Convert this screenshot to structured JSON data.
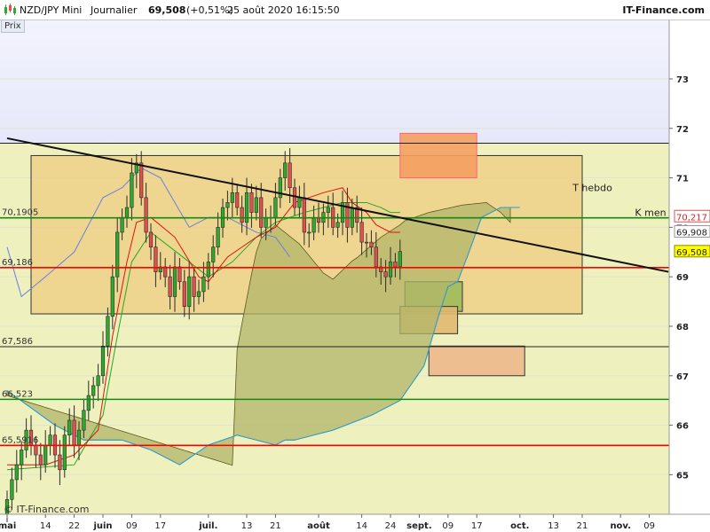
{
  "header": {
    "symbol": "NZD/JPY Mini",
    "period": "Journalier",
    "last": "69,508",
    "change": "(+0,51%)",
    "datetime": "25 août 2020 16:15:50",
    "brand": "IT-Finance.com",
    "panel_tab": "Prix",
    "watermark": "© IT-Finance.com"
  },
  "colors": {
    "bull": "#2eaa2e",
    "bear": "#e05050",
    "tenkan": "#e01010",
    "kijun": "#22aa22",
    "chikou": "#6a7fe0",
    "ssb": "#22a0dd",
    "cloud_green": "#b2b66a",
    "cloud_bear": "#c6b06a",
    "trend": "#111111",
    "support_red": "#ff0000",
    "support_green": "#138a13"
  },
  "chart_data": {
    "type": "candlestick",
    "instrument": "NZD/JPY Mini",
    "timeframe": "Journalier",
    "y_axis": {
      "ylim": [
        64.2,
        74.2
      ],
      "ticks": [
        65,
        66,
        67,
        68,
        69,
        70,
        71,
        72,
        73
      ]
    },
    "x_axis": {
      "ticks": [
        {
          "label": "mai",
          "bold": true,
          "i": 0
        },
        {
          "label": "14",
          "i": 8
        },
        {
          "label": "22",
          "i": 14
        },
        {
          "label": "juin",
          "bold": true,
          "i": 20
        },
        {
          "label": "09",
          "i": 26
        },
        {
          "label": "17",
          "i": 32
        },
        {
          "label": "juil.",
          "bold": true,
          "i": 42
        },
        {
          "label": "13",
          "i": 50
        },
        {
          "label": "21",
          "i": 56
        },
        {
          "label": "août",
          "bold": true,
          "i": 65
        },
        {
          "label": "14",
          "i": 74
        },
        {
          "label": "24",
          "i": 80
        },
        {
          "label": "sept.",
          "bold": true,
          "i": 86
        },
        {
          "label": "09",
          "i": 92
        },
        {
          "label": "17",
          "i": 98
        },
        {
          "label": "oct.",
          "bold": true,
          "i": 107
        },
        {
          "label": "13",
          "i": 114
        },
        {
          "label": "21",
          "i": 120
        },
        {
          "label": "nov.",
          "bold": true,
          "i": 128
        },
        {
          "label": "09",
          "i": 134
        }
      ]
    },
    "candles_close": [
      64.5,
      64.9,
      65.2,
      65.5,
      65.9,
      65.6,
      65.4,
      65.2,
      65.6,
      65.8,
      65.4,
      65.1,
      65.8,
      66.1,
      65.6,
      65.9,
      66.3,
      66.6,
      66.8,
      67.0,
      67.6,
      68.2,
      69.0,
      69.9,
      70.2,
      70.4,
      71.1,
      71.3,
      70.6,
      69.9,
      69.6,
      69.1,
      69.2,
      69.0,
      68.6,
      69.2,
      68.9,
      68.4,
      69.0,
      68.6,
      68.7,
      69.0,
      69.3,
      69.6,
      70.0,
      70.4,
      70.5,
      70.7,
      70.4,
      70.1,
      70.7,
      70.3,
      70.6,
      70.0,
      70.2,
      70.2,
      70.6,
      71.0,
      71.3,
      70.8,
      70.4,
      70.6,
      69.9,
      69.9,
      70.2,
      70.1,
      70.3,
      70.4,
      70.0,
      70.1,
      70.5,
      70.0,
      70.4,
      70.1,
      69.7,
      69.7,
      69.6,
      69.2,
      69.1,
      69.0,
      69.3,
      69.2,
      69.51
    ],
    "tenkan": [
      [
        0,
        65.2
      ],
      [
        8,
        65.2
      ],
      [
        14,
        65.4
      ],
      [
        19,
        65.9
      ],
      [
        22,
        67.8
      ],
      [
        25,
        69.3
      ],
      [
        27,
        70.1
      ],
      [
        30,
        70.2
      ],
      [
        35,
        69.8
      ],
      [
        40,
        69.0
      ],
      [
        42,
        68.9
      ],
      [
        46,
        69.4
      ],
      [
        52,
        69.8
      ],
      [
        56,
        70.0
      ],
      [
        60,
        70.5
      ],
      [
        66,
        70.7
      ],
      [
        70,
        70.8
      ],
      [
        72,
        70.5
      ],
      [
        75,
        70.3
      ],
      [
        77,
        70.05
      ],
      [
        80,
        69.9
      ],
      [
        82,
        69.9
      ]
    ],
    "kijun": [
      [
        0,
        65.1
      ],
      [
        14,
        65.2
      ],
      [
        20,
        66.2
      ],
      [
        23,
        67.8
      ],
      [
        26,
        69.3
      ],
      [
        30,
        69.9
      ],
      [
        38,
        69.3
      ],
      [
        42,
        69.0
      ],
      [
        47,
        69.3
      ],
      [
        52,
        69.8
      ],
      [
        56,
        70.1
      ],
      [
        62,
        70.3
      ],
      [
        70,
        70.5
      ],
      [
        75,
        70.5
      ],
      [
        78,
        70.4
      ],
      [
        80,
        70.3
      ],
      [
        82,
        70.3
      ]
    ],
    "chikou": [
      [
        0,
        69.6
      ],
      [
        3,
        68.6
      ],
      [
        8,
        69.0
      ],
      [
        14,
        69.5
      ],
      [
        20,
        70.6
      ],
      [
        24,
        70.8
      ],
      [
        28,
        71.2
      ],
      [
        32,
        71.0
      ],
      [
        38,
        70.0
      ],
      [
        42,
        70.2
      ],
      [
        46,
        70.2
      ],
      [
        52,
        69.9
      ],
      [
        56,
        69.8
      ],
      [
        59,
        69.4
      ]
    ],
    "ssb": [
      [
        0,
        66.7
      ],
      [
        10,
        66.0
      ],
      [
        16,
        65.7
      ],
      [
        24,
        65.7
      ],
      [
        30,
        65.5
      ],
      [
        36,
        65.2
      ],
      [
        42,
        65.6
      ],
      [
        48,
        65.8
      ],
      [
        52,
        65.7
      ],
      [
        56,
        65.6
      ],
      [
        58,
        65.7
      ],
      [
        60,
        65.7
      ],
      [
        68,
        65.9
      ],
      [
        76,
        66.2
      ],
      [
        82,
        66.5
      ],
      [
        87,
        67.2
      ],
      [
        90,
        68.2
      ],
      [
        92,
        68.8
      ],
      [
        94,
        68.9
      ],
      [
        96,
        69.4
      ],
      [
        99,
        70.2
      ],
      [
        103,
        70.4
      ],
      [
        107,
        70.4
      ]
    ],
    "ssa_future": [
      [
        82,
        70.1
      ],
      [
        88,
        70.3
      ],
      [
        95,
        70.45
      ],
      [
        100,
        70.5
      ],
      [
        103,
        70.3
      ],
      [
        105,
        70.1
      ]
    ],
    "levels": [
      {
        "value": 70.1905,
        "label": "70,1905",
        "color": "green"
      },
      {
        "value": 69.186,
        "label": "69,186",
        "color": "red"
      },
      {
        "value": 67.586,
        "label": "67,586",
        "color": "black"
      },
      {
        "value": 66.523,
        "label": "66,523",
        "color": "green"
      },
      {
        "value": 65.5916,
        "label": "65,5916",
        "color": "red"
      },
      {
        "value": 71.7,
        "label": "",
        "color": "black"
      }
    ],
    "trendline": {
      "from": [
        0,
        71.8
      ],
      "to": [
        138,
        69.1
      ]
    },
    "zones": [
      {
        "x": [
          5,
          120
        ],
        "y": [
          68.25,
          71.45
        ],
        "fill": "#f0c878",
        "opacity": 0.65,
        "name": "weekly-range-zone"
      },
      {
        "x": [
          82,
          98
        ],
        "y": [
          71.0,
          71.9
        ],
        "fill": "#f4a060",
        "stroke": "#ff6080",
        "name": "upper-target-zone"
      },
      {
        "x": [
          83,
          95
        ],
        "y": [
          68.3,
          68.9
        ],
        "fill": "#9dbb5a",
        "name": "green-support-zone"
      },
      {
        "x": [
          82,
          94
        ],
        "y": [
          67.85,
          68.4
        ],
        "fill": "#e0b870",
        "name": "lower-support-zone"
      },
      {
        "x": [
          88,
          108
        ],
        "y": [
          67.0,
          67.6
        ],
        "fill": "#ecb98b",
        "name": "bottom-target-zone"
      }
    ],
    "annotations": [
      {
        "text": "T hebdo",
        "i": 118,
        "y": 70.8
      },
      {
        "text": "K men",
        "i": 131,
        "y": 70.3
      }
    ],
    "price_tags": [
      {
        "label": "70,217",
        "value": 70.217,
        "bg": "#ffffff",
        "border": "#e05050",
        "color": "#e02020"
      },
      {
        "label": "69,908",
        "value": 69.908,
        "bg": "#ffffff",
        "border": "#999999",
        "color": "#222222"
      },
      {
        "label": "69,508",
        "value": 69.508,
        "bg": "#ffff00",
        "border": "#888800",
        "color": "#222222"
      }
    ]
  }
}
